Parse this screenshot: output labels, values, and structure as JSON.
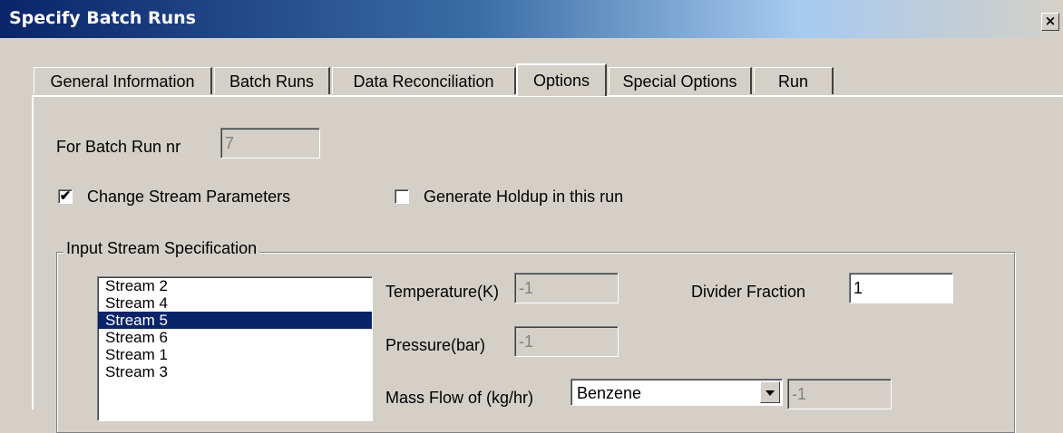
{
  "window": {
    "title": "Specify Batch Runs",
    "close_glyph": "×"
  },
  "tabs": [
    {
      "label": "General Information"
    },
    {
      "label": "Batch Runs"
    },
    {
      "label": "Data Reconciliation"
    },
    {
      "label": "Options"
    },
    {
      "label": "Special Options"
    },
    {
      "label": "Run"
    }
  ],
  "active_tab": "Options",
  "batch_run": {
    "label": "For Batch Run nr",
    "value": "7"
  },
  "checkboxes": {
    "change_stream": {
      "label": "Change Stream Parameters",
      "checked": true,
      "mark": "✔"
    },
    "generate_holdup": {
      "label": "Generate Holdup in this run",
      "checked": false,
      "mark": ""
    }
  },
  "group": {
    "label": "Input Stream Specification",
    "streams": [
      "Stream 2",
      "Stream 4",
      "Stream 5",
      "Stream 6",
      "Stream 1",
      "Stream 3"
    ],
    "selected_stream": "Stream 5",
    "temperature": {
      "label": "Temperature(K)",
      "value": "-1"
    },
    "pressure": {
      "label": "Pressure(bar)",
      "value": "-1"
    },
    "divider": {
      "label": "Divider Fraction",
      "value": "1"
    },
    "mass_flow": {
      "label": "Mass Flow of (kg/hr)",
      "component": "Benzene",
      "value": "-1"
    }
  },
  "colors": {
    "title_start": "#0a246a",
    "selection": "#0a246a",
    "face": "#d4d0c8"
  },
  "icons": {
    "close": "close-icon",
    "dropdown": "chevron-down-icon",
    "check": "checkmark-icon"
  }
}
